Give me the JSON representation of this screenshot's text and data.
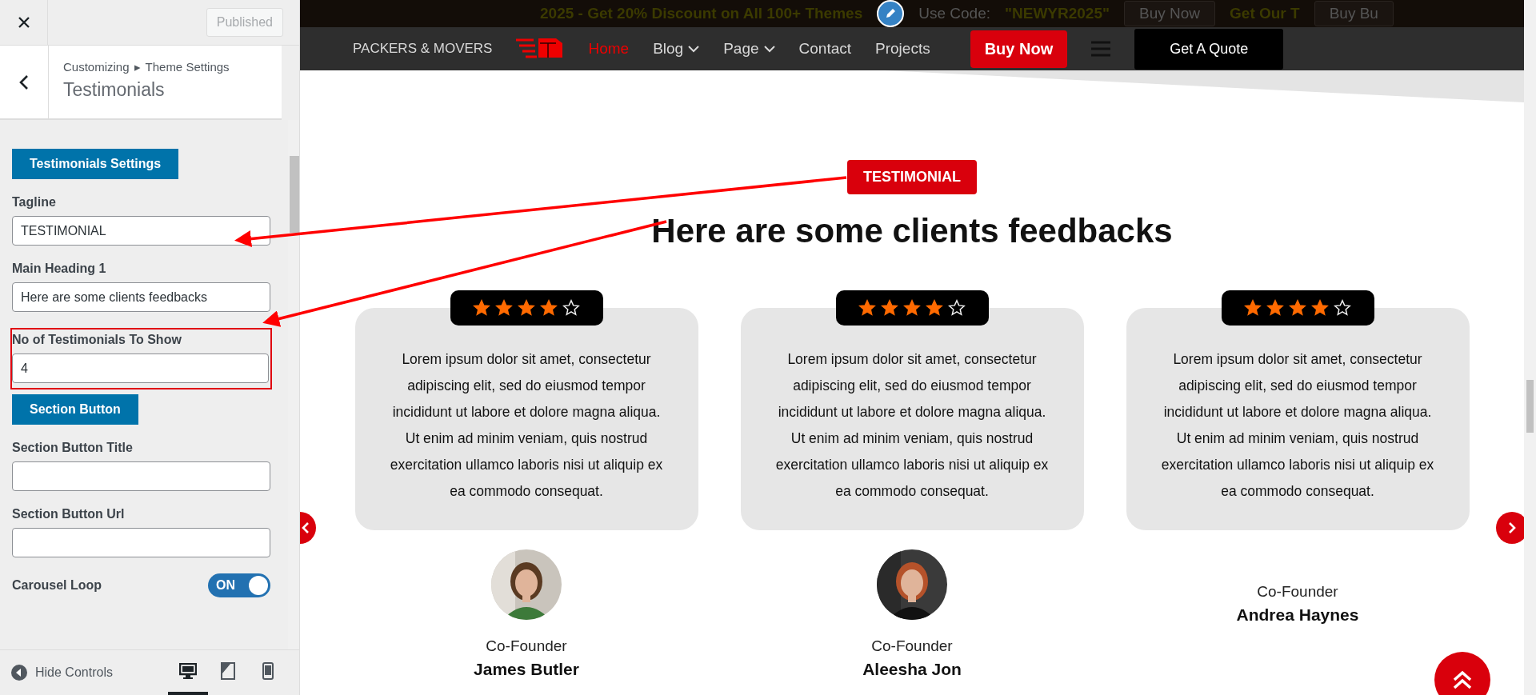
{
  "sidebar": {
    "publish_button": "Published",
    "breadcrumb": {
      "parent": "Customizing",
      "separator": "▸",
      "section": "Theme Settings"
    },
    "title": "Testimonials",
    "controls": [
      {
        "kind": "section",
        "label": "Testimonials Settings"
      },
      {
        "kind": "text",
        "label": "Tagline",
        "value": "TESTIMONIAL",
        "highlighted": false
      },
      {
        "kind": "text",
        "label": "Main Heading 1",
        "value": "Here are some clients feedbacks",
        "highlighted": false
      },
      {
        "kind": "text",
        "label": "No of Testimonials To Show",
        "value": "4",
        "highlighted": true
      },
      {
        "kind": "section",
        "label": "Section Button"
      },
      {
        "kind": "text",
        "label": "Section Button Title",
        "highlighted": false
      },
      {
        "kind": "text",
        "label": "Section Button Url",
        "highlighted": false
      },
      {
        "kind": "toggle",
        "label": "Carousel Loop",
        "on": true,
        "state_label": "ON"
      }
    ],
    "footer": {
      "label": "Hide Controls",
      "devices": [
        {
          "kind": "desktop",
          "selected": true
        },
        {
          "kind": "tablet",
          "selected": false
        },
        {
          "kind": "mobile",
          "selected": false
        }
      ]
    }
  },
  "promo_bar": {
    "text": "2025 - Get 20% Discount on All 100+ Themes",
    "code_label": "Use Code:",
    "code": "\"NEWYR2025\"",
    "button": "Buy Now",
    "bundle_text": "Get Our T",
    "bundle_button": "Buy Bu"
  },
  "navbar": {
    "logo": "PACKERS & MOVERS",
    "items": [
      {
        "label": "Home",
        "selected": true,
        "has_menu": false
      },
      {
        "label": "Blog",
        "selected": false,
        "has_menu": true
      },
      {
        "label": "Page",
        "selected": false,
        "has_menu": true
      },
      {
        "label": "Contact",
        "selected": false,
        "has_menu": false
      },
      {
        "label": "Projects",
        "selected": false,
        "has_menu": false
      }
    ],
    "buy_button": "Buy Now",
    "quote_button": "Get A Quote"
  },
  "section": {
    "tagline": "TESTIMONIAL",
    "heading": "Here are some clients feedbacks"
  },
  "testimonials": [
    {
      "stars": 4,
      "text": "Lorem ipsum dolor sit amet, consectetur adipiscing elit, sed do eiusmod tempor incididunt ut labore et dolore magna aliqua. Ut enim ad minim veniam, quis nostrud exercitation ullamco laboris nisi ut aliquip ex ea commodo consequat.",
      "role": "Co-Founder",
      "name": "James Butler"
    },
    {
      "stars": 4,
      "text": "Lorem ipsum dolor sit amet, consectetur adipiscing elit, sed do eiusmod tempor incididunt ut labore et dolore magna aliqua. Ut enim ad minim veniam, quis nostrud exercitation ullamco laboris nisi ut aliquip ex ea commodo consequat.",
      "role": "Co-Founder",
      "name": "Aleesha Jon"
    },
    {
      "stars": 4,
      "text": "Lorem ipsum dolor sit amet, consectetur adipiscing elit, sed do eiusmod tempor incididunt ut labore et dolore magna aliqua. Ut enim ad minim veniam, quis nostrud exercitation ullamco laboris nisi ut aliquip ex ea commodo consequat.",
      "role": "Co-Founder",
      "name": "Andrea Haynes"
    }
  ]
}
